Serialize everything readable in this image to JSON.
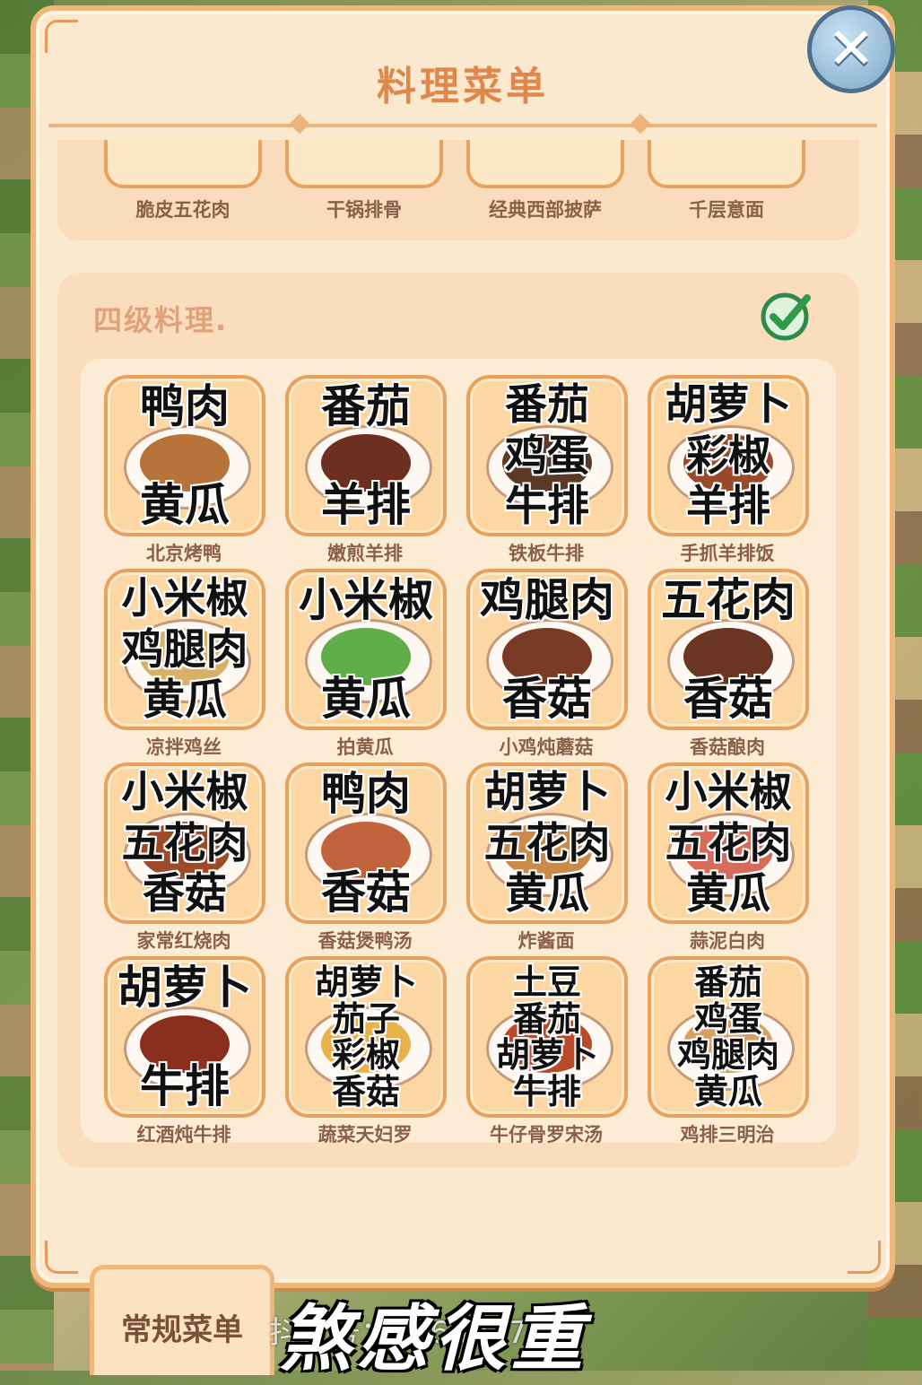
{
  "header": {
    "title": "料理菜单",
    "close_icon": "close-icon"
  },
  "previous_row": [
    "脆皮五花肉",
    "干锅排骨",
    "经典西部披萨",
    "千层意面"
  ],
  "section": {
    "title": "四级料理.",
    "complete_icon": "check-icon"
  },
  "dishes": [
    {
      "name": "北京烤鸭",
      "ingredients": [
        "鸭肉",
        "黄瓜"
      ],
      "food_color": "#b8733a"
    },
    {
      "name": "嫩煎羊排",
      "ingredients": [
        "番茄",
        "羊排"
      ],
      "food_color": "#6b2e1f"
    },
    {
      "name": "铁板牛排",
      "ingredients": [
        "番茄",
        "鸡蛋",
        "牛排"
      ],
      "food_color": "#5a3a26"
    },
    {
      "name": "手抓羊排饭",
      "ingredients": [
        "胡萝卜",
        "彩椒",
        "羊排"
      ],
      "food_color": "#9a4a2a"
    },
    {
      "name": "凉拌鸡丝",
      "ingredients": [
        "小米椒",
        "鸡腿肉",
        "黄瓜"
      ],
      "food_color": "#d9b06a"
    },
    {
      "name": "拍黄瓜",
      "ingredients": [
        "小米椒",
        "黄瓜"
      ],
      "food_color": "#5fae4a"
    },
    {
      "name": "小鸡炖蘑菇",
      "ingredients": [
        "鸡腿肉",
        "香菇"
      ],
      "food_color": "#7a3b26"
    },
    {
      "name": "香菇酿肉",
      "ingredients": [
        "五花肉",
        "香菇"
      ],
      "food_color": "#6a3522"
    },
    {
      "name": "家常红烧肉",
      "ingredients": [
        "小米椒",
        "五花肉",
        "香菇"
      ],
      "food_color": "#9c4a2a"
    },
    {
      "name": "香菇煲鸭汤",
      "ingredients": [
        "鸭肉",
        "香菇"
      ],
      "food_color": "#c0643e"
    },
    {
      "name": "炸酱面",
      "ingredients": [
        "胡萝卜",
        "五花肉",
        "黄瓜"
      ],
      "food_color": "#c98a4a"
    },
    {
      "name": "蒜泥白肉",
      "ingredients": [
        "小米椒",
        "五花肉",
        "黄瓜"
      ],
      "food_color": "#d86a5a"
    },
    {
      "name": "红酒炖牛排",
      "ingredients": [
        "胡萝卜",
        "牛排"
      ],
      "food_color": "#8a2e1e"
    },
    {
      "name": "蔬菜天妇罗",
      "ingredients": [
        "胡萝卜",
        "茄子",
        "彩椒",
        "香菇"
      ],
      "food_color": "#e8b24a"
    },
    {
      "name": "牛仔骨罗宋汤",
      "ingredients": [
        "土豆",
        "番茄",
        "胡萝卜",
        "牛排"
      ],
      "food_color": "#b84a2a"
    },
    {
      "name": "鸡排三明治",
      "ingredients": [
        "番茄",
        "鸡蛋",
        "鸡腿肉",
        "黄瓜"
      ],
      "food_color": "#d8a060"
    }
  ],
  "bottom": {
    "tab_regular": "常规菜单",
    "caption": "煞感很重",
    "watermark": "抖音号：4166977614"
  },
  "colors": {
    "accent": "#e0874c",
    "card_border": "#e8a25d",
    "panel_bg": "#fbe9cf"
  }
}
